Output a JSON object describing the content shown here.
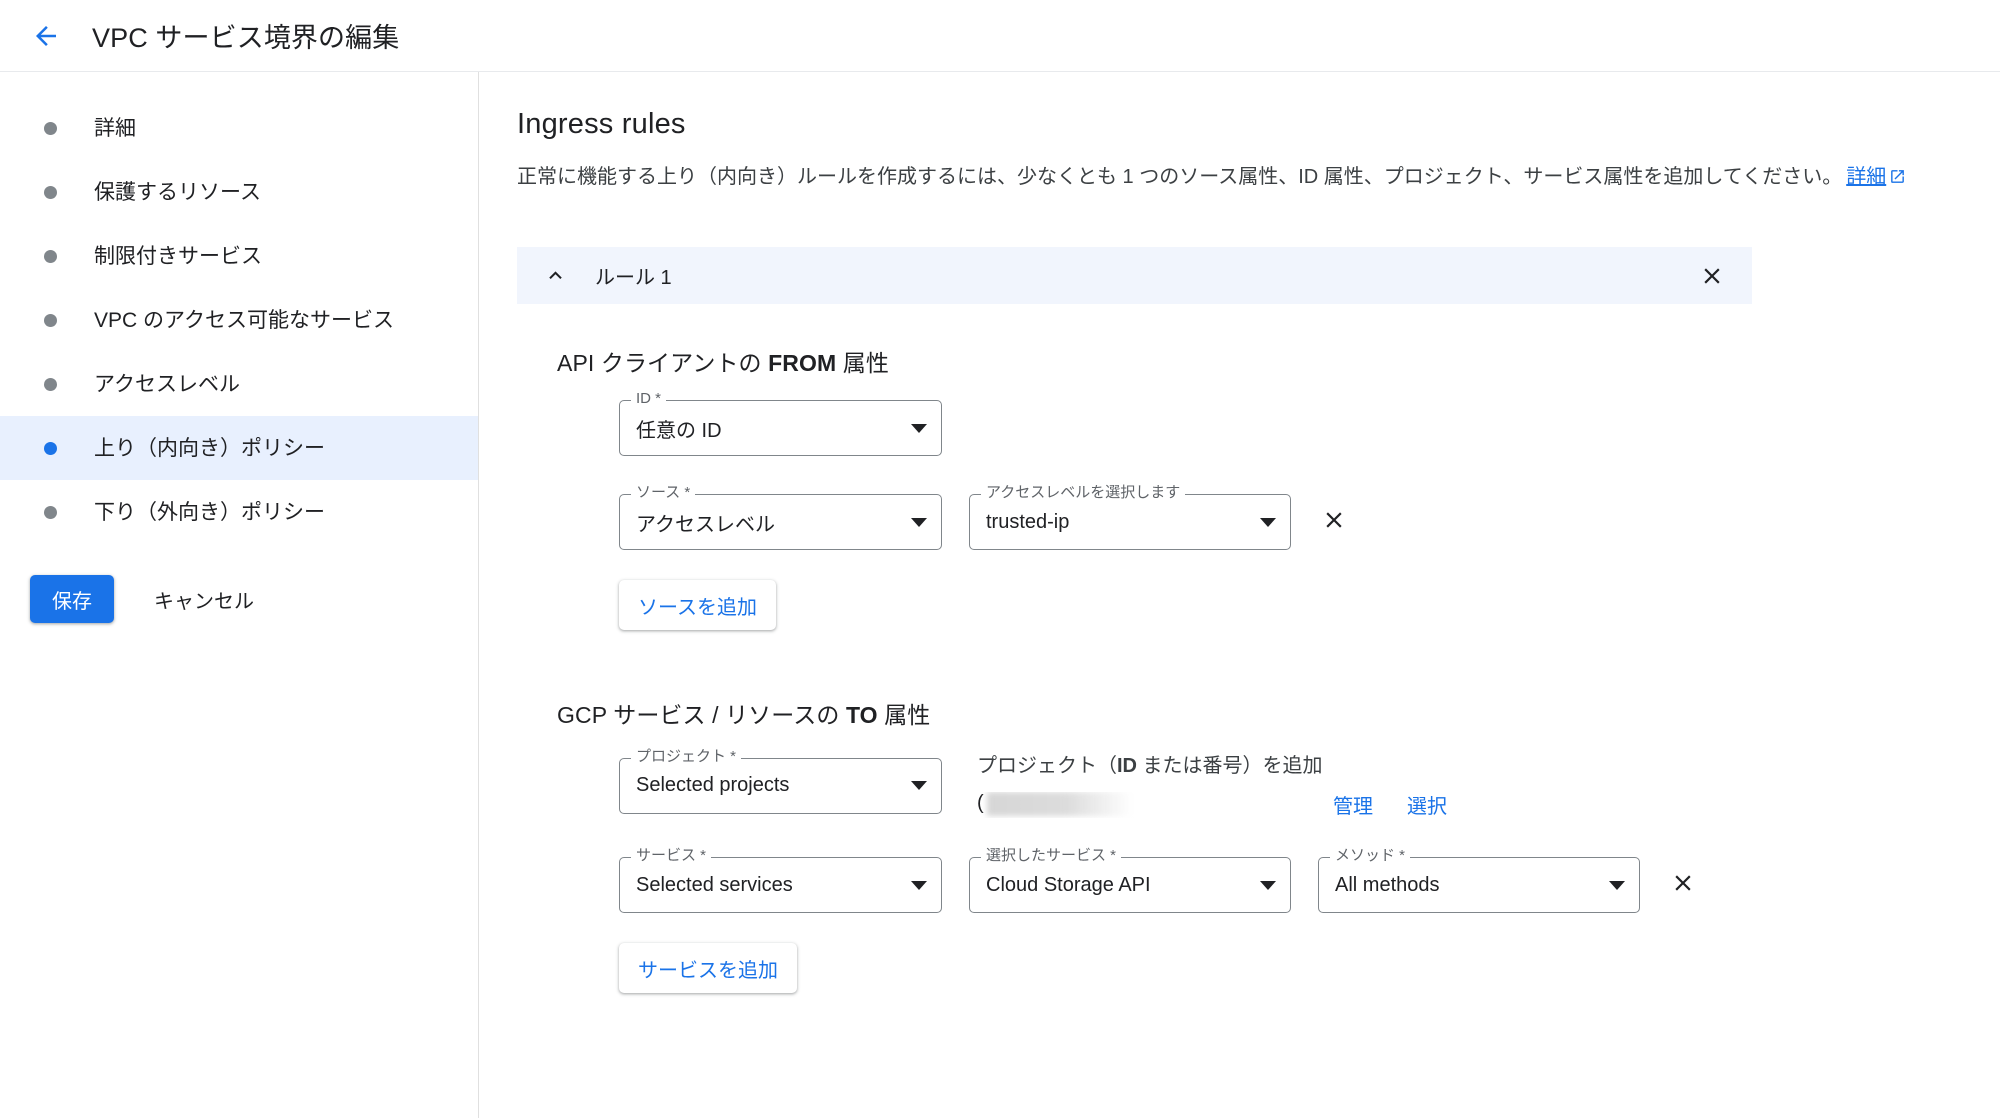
{
  "header": {
    "back_icon": "arrow-back-icon",
    "title": "VPC サービス境界の編集"
  },
  "sidebar": {
    "items": [
      {
        "label": "詳細",
        "active": false
      },
      {
        "label": "保護するリソース",
        "active": false
      },
      {
        "label": "制限付きサービス",
        "active": false
      },
      {
        "label": "VPC のアクセス可能なサービス",
        "active": false
      },
      {
        "label": "アクセスレベル",
        "active": false
      },
      {
        "label": "上り（内向き）ポリシー",
        "active": true
      },
      {
        "label": "下り（外向き）ポリシー",
        "active": false
      }
    ],
    "save_label": "保存",
    "cancel_label": "キャンセル"
  },
  "main": {
    "section_title": "Ingress rules",
    "section_desc": "正常に機能する上り（内向き）ルールを作成するには、少なくとも 1 つのソース属性、ID 属性、プロジェクト、サービス属性を追加してください。",
    "section_desc_link": "詳細",
    "rule": {
      "title": "ルール 1",
      "collapse_icon": "chevron-up-icon",
      "close_icon": "close-icon"
    },
    "from_attrs": {
      "heading_pre": "API クライアントの ",
      "heading_bold": "FROM",
      "heading_post": " 属性",
      "id_field": {
        "legend": "ID *",
        "value": "任意の ID"
      },
      "source_field": {
        "legend": "ソース *",
        "value": "アクセスレベル"
      },
      "access_level_field": {
        "legend": "アクセスレベルを選択します",
        "value": "trusted-ip"
      },
      "remove_icon": "close-icon",
      "add_source_label": "ソースを追加"
    },
    "to_attrs": {
      "heading_pre": "GCP サービス / リソースの ",
      "heading_bold": "TO",
      "heading_post": " 属性",
      "project_field": {
        "legend": "プロジェクト *",
        "value": "Selected projects"
      },
      "project_add_caption_pre": "プロジェクト（",
      "project_add_caption_bold": "ID",
      "project_add_caption_post": " または番号）を追加",
      "project_value": "(",
      "project_manage_label": "管理",
      "project_select_label": "選択",
      "service_field": {
        "legend": "サービス *",
        "value": "Selected services"
      },
      "selected_service_field": {
        "legend": "選択したサービス *",
        "value": "Cloud Storage API"
      },
      "method_field": {
        "legend": "メソッド *",
        "value": "All methods"
      },
      "remove_icon": "close-icon",
      "add_service_label": "サービスを追加"
    }
  },
  "colors": {
    "accent": "#1a73e8",
    "active_bg": "#e8f0fe",
    "rule_header_bg": "#f1f5fd",
    "border": "#80868b"
  }
}
